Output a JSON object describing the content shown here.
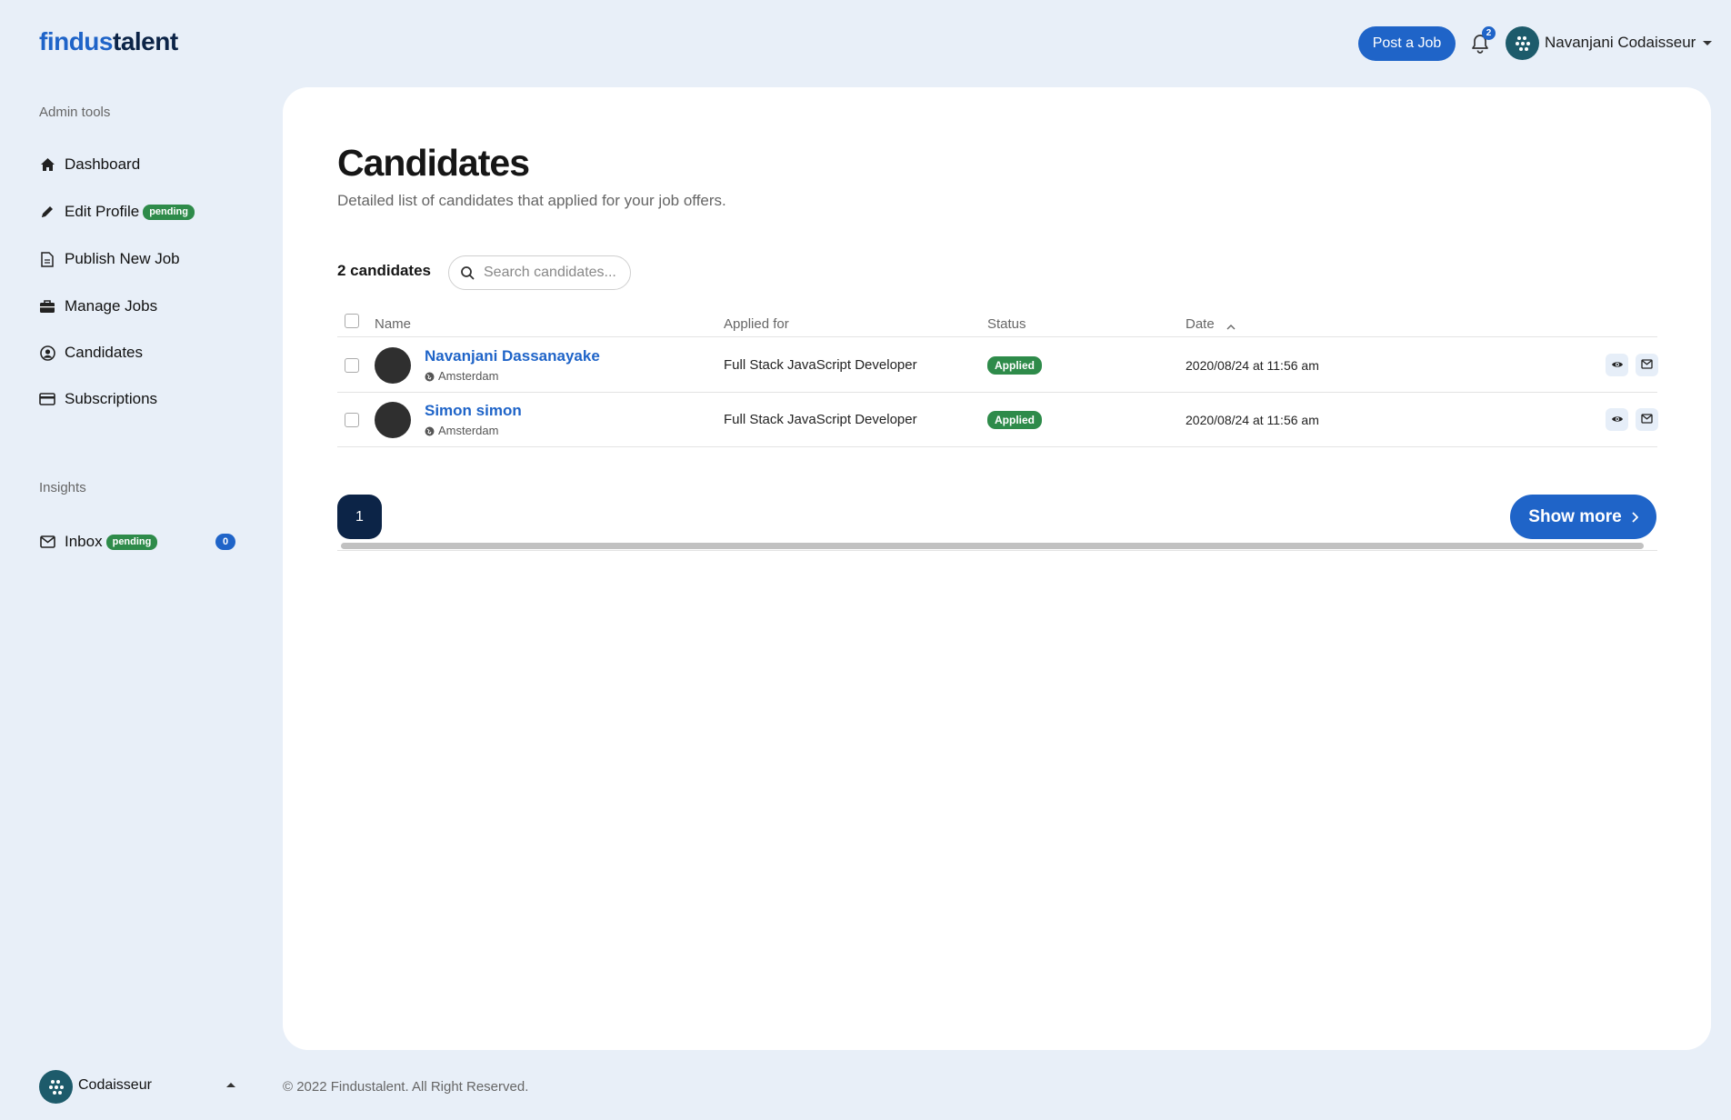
{
  "brand": {
    "part1": "findus",
    "part2": "talent"
  },
  "header": {
    "post_job_label": "Post a Job",
    "notification_count": "2",
    "user_name": "Navanjani Codaisseur"
  },
  "sidebar": {
    "admin_section": "Admin tools",
    "items": [
      {
        "label": "Dashboard",
        "icon": "home-icon"
      },
      {
        "label": "Edit Profile",
        "icon": "pencil-icon",
        "badge": "pending"
      },
      {
        "label": "Publish New Job",
        "icon": "document-icon"
      },
      {
        "label": "Manage Jobs",
        "icon": "briefcase-icon"
      },
      {
        "label": "Candidates",
        "icon": "user-circle-icon"
      },
      {
        "label": "Subscriptions",
        "icon": "credit-card-icon"
      }
    ],
    "insights_section": "Insights",
    "inbox": {
      "label": "Inbox",
      "badge": "pending",
      "count": "0"
    },
    "footer_user": "Codaisseur"
  },
  "main": {
    "title": "Candidates",
    "subtitle": "Detailed list of candidates that applied for your job offers.",
    "count_label": "2 candidates",
    "search_placeholder": "Search candidates...",
    "columns": {
      "name": "Name",
      "applied_for": "Applied for",
      "status": "Status",
      "date": "Date"
    },
    "rows": [
      {
        "name": "Navanjani Dassanayake",
        "location": "Amsterdam",
        "applied_for": "Full Stack JavaScript Developer",
        "status": "Applied",
        "date": "2020/08/24 at 11:56 am"
      },
      {
        "name": "Simon simon",
        "location": "Amsterdam",
        "applied_for": "Full Stack JavaScript Developer",
        "status": "Applied",
        "date": "2020/08/24 at 11:56 am"
      }
    ],
    "page": "1",
    "show_more_label": "Show more"
  },
  "footer": {
    "copyright": "© 2022 Findustalent. All Right Reserved."
  },
  "colors": {
    "accent": "#1f64c8",
    "navy": "#0c2447",
    "success": "#2e8b4a",
    "background": "#e8eff8"
  }
}
